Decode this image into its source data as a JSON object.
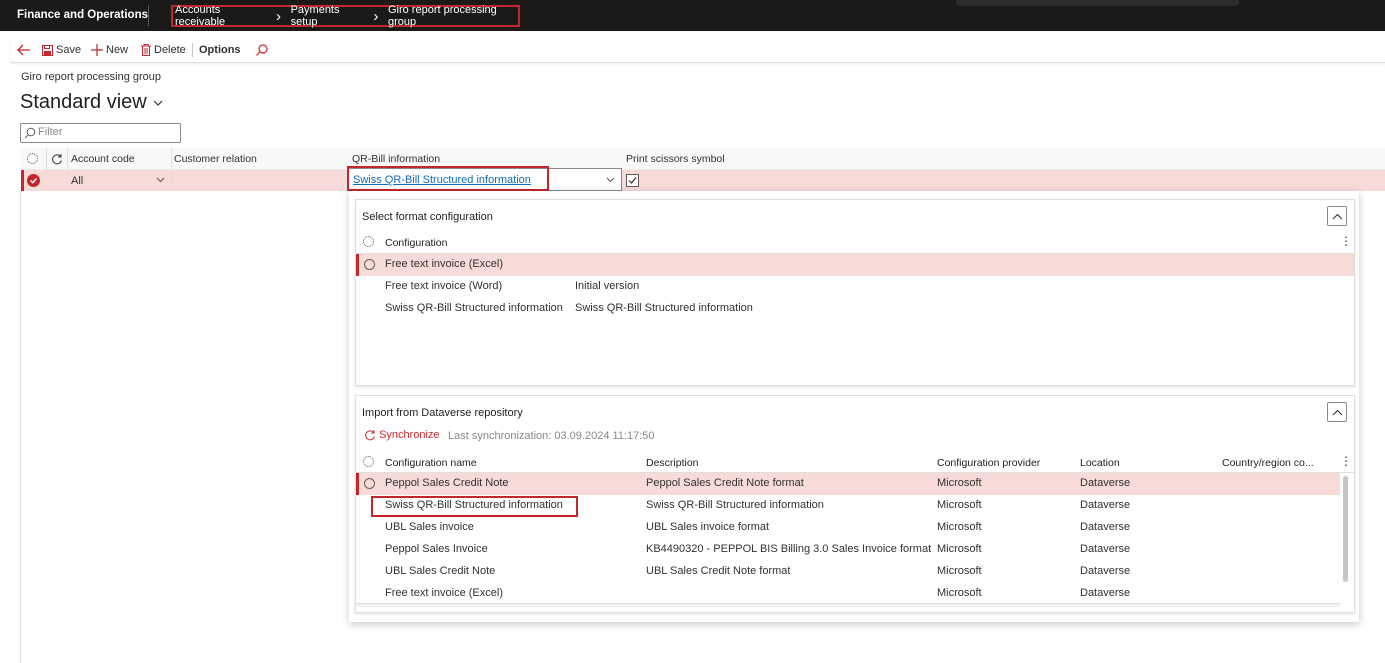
{
  "app": {
    "title": "Finance and Operations"
  },
  "breadcrumb": [
    "Accounts receivable",
    "Payments setup",
    "Giro report processing group"
  ],
  "actions": {
    "save": "Save",
    "new": "New",
    "delete": "Delete",
    "options": "Options"
  },
  "page": {
    "caption": "Giro report processing group",
    "view": "Standard view",
    "filter_placeholder": "Filter"
  },
  "grid": {
    "columns": [
      "Account code",
      "Customer relation",
      "QR-Bill information",
      "Print scissors symbol"
    ],
    "row": {
      "account_code": "All",
      "customer_relation": "",
      "qr_bill": "Swiss QR-Bill Structured information",
      "print_scissors": true
    }
  },
  "select_format": {
    "title": "Select format configuration",
    "column": "Configuration",
    "rows": [
      {
        "name": "Free text invoice (Excel)",
        "desc": ""
      },
      {
        "name": "Free text invoice (Word)",
        "desc": "Initial version"
      },
      {
        "name": "Swiss QR-Bill Structured information",
        "desc": "Swiss QR-Bill Structured information"
      }
    ]
  },
  "import": {
    "title": "Import from Dataverse repository",
    "sync_label": "Synchronize",
    "last_sync": "Last synchronization: 03.09.2024 11:17:50",
    "columns": [
      "Configuration name",
      "Description",
      "Configuration provider",
      "Location",
      "Country/region co..."
    ],
    "rows": [
      {
        "name": "Peppol Sales Credit Note",
        "desc": "Peppol Sales Credit Note format",
        "provider": "Microsoft",
        "location": "Dataverse"
      },
      {
        "name": "Swiss QR-Bill Structured information",
        "desc": "Swiss QR-Bill Structured information",
        "provider": "Microsoft",
        "location": "Dataverse"
      },
      {
        "name": "UBL Sales invoice",
        "desc": "UBL Sales invoice format",
        "provider": "Microsoft",
        "location": "Dataverse"
      },
      {
        "name": "Peppol Sales Invoice",
        "desc": "KB4490320 - PEPPOL BIS Billing 3.0 Sales Invoice format",
        "provider": "Microsoft",
        "location": "Dataverse"
      },
      {
        "name": "UBL Sales Credit Note",
        "desc": "UBL Sales Credit Note format",
        "provider": "Microsoft",
        "location": "Dataverse"
      },
      {
        "name": "Free text invoice (Excel)",
        "desc": "",
        "provider": "Microsoft",
        "location": "Dataverse"
      }
    ]
  },
  "colors": {
    "accent": "#c4262e",
    "selection": "#f6dbd9",
    "topbar": "#1b1a19",
    "link": "#0f6cbd"
  }
}
